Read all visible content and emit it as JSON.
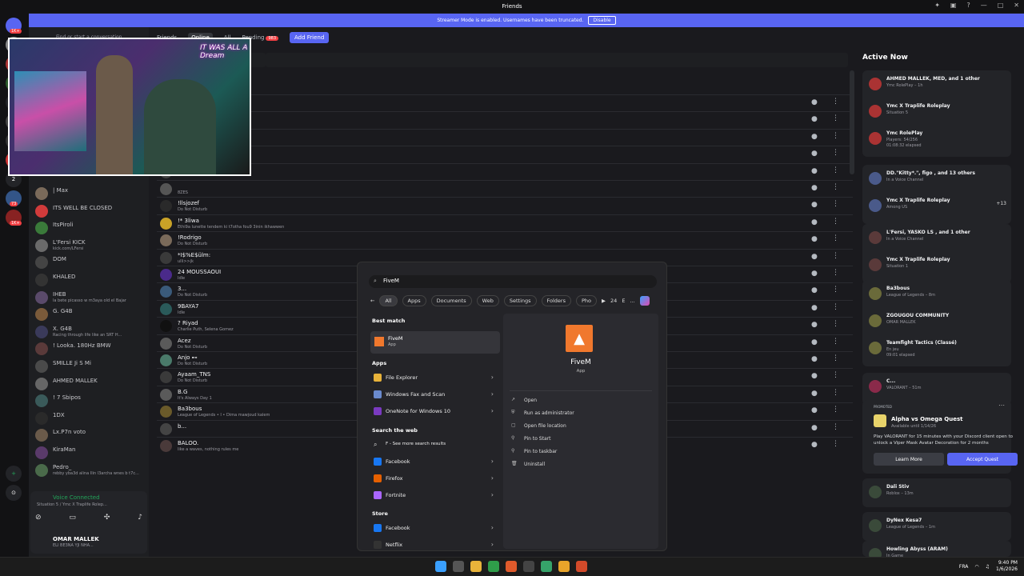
{
  "window": {
    "title": "Friends"
  },
  "banner": {
    "text": "Streamer Mode is enabled. Usernames have been truncated.",
    "button": "Disable"
  },
  "servers": [
    {
      "letter": "",
      "color": "#5865f2",
      "badge": "1K+"
    },
    {
      "letter": "",
      "color": "#888888",
      "badge": "460"
    },
    {
      "letter": "",
      "color": "#aa3333",
      "badge": "127"
    },
    {
      "letter": "",
      "color": "#2b5a2b",
      "badge": "373"
    },
    {
      "letter": "D",
      "color": "#232428",
      "badge": ""
    },
    {
      "letter": "",
      "color": "#444444",
      "badge": "116"
    },
    {
      "letter": "",
      "color": "#333333",
      "badge": "23"
    },
    {
      "letter": "",
      "color": "#cc3333",
      "badge": "227"
    },
    {
      "letter": "2",
      "color": "#232428",
      "badge": ""
    },
    {
      "letter": "",
      "color": "#335588",
      "badge": "73"
    },
    {
      "letter": "",
      "color": "#882222",
      "badge": "1K+"
    }
  ],
  "dm": {
    "search_placeholder": "Find or start a conversation",
    "items": [
      {
        "name": "| Max",
        "status": "",
        "color": "#7a6a5a"
      },
      {
        "name": "ITS WELL BE CLOSED",
        "status": "",
        "color": "#d13b3b"
      },
      {
        "name": "ItsPiroli",
        "status": "",
        "color": "#3a7a3a"
      },
      {
        "name": "L'Fersi KICK",
        "status": "kick.com/LFersi",
        "color": "#6a6a6a"
      },
      {
        "name": "DOM",
        "status": "",
        "color": "#444444"
      },
      {
        "name": "KHALED",
        "status": "",
        "color": "#333333"
      },
      {
        "name": "IHEB",
        "status": "la bete picasso w m3aya old el Bajar",
        "color": "#5a4a6a"
      },
      {
        "name": "G. G4B",
        "status": "",
        "color": "#7a5a3a"
      },
      {
        "name": "X. G4B",
        "status": "Racing through life like an SRT H...",
        "color": "#3a3a5a"
      },
      {
        "name": "! Lооkа. 180Hz BMW",
        "status": "",
        "color": "#5a3a3a"
      },
      {
        "name": "SMILLE Ji S Mi",
        "status": "",
        "color": "#4a4a4a"
      },
      {
        "name": "AHMED MALLEK",
        "status": "",
        "color": "#666666"
      },
      {
        "name": "! 7 Sbipos",
        "status": "",
        "color": "#3a5a5a"
      },
      {
        "name": "1DX",
        "status": "",
        "color": "#2a2a2a"
      },
      {
        "name": "Lx.P7n voto",
        "status": "",
        "color": "#6a5a4a"
      },
      {
        "name": "KiraMan",
        "status": "",
        "color": "#5a3a6a"
      },
      {
        "name": "Pedro_",
        "status": "rebby yba3d alina Ilin l3archa wnes b t7c...",
        "color": "#4a6a4a"
      }
    ],
    "voice": {
      "title": "Voice Connected",
      "sub": "Situation 5 / Ymc X Traplife Rolep..."
    },
    "user": {
      "name": "OMAR MALLEK",
      "status": "ELI BE3NA YJI NHA..."
    }
  },
  "nav": {
    "friends": "Friends",
    "online": "Online",
    "all": "All",
    "pending": "Pending",
    "pending_count": "983",
    "add": "Add Friend"
  },
  "friends": [
    {
      "name": "",
      "status": "",
      "color": "#444444"
    },
    {
      "name": "",
      "status": "",
      "color": "#444444"
    },
    {
      "name": "",
      "status": "",
      "color": "#444444"
    },
    {
      "name": "",
      "status": "",
      "color": "#444444"
    },
    {
      "name": "",
      "status": "",
      "color": "#444444"
    },
    {
      "name": "",
      "status": "8ZES",
      "color": "#555555"
    },
    {
      "name": "!llsjozef",
      "status": "Do Not Disturb",
      "color": "#2a2a2a"
    },
    {
      "name": "!* 3liwa",
      "status": "Ethi9a lunette tendem ki t7otha fou9 3inin ikhawwen",
      "color": "#c9a227"
    },
    {
      "name": "!Rodrigo",
      "status": "Do Not Disturb",
      "color": "#7a6a5a"
    },
    {
      "name": "*I$%E$ülm:",
      "status": "ulli>>jk",
      "color": "#3a3a3a"
    },
    {
      "name": "24 MOUSSAOUI",
      "status": "Idle",
      "color": "#4a2a8a"
    },
    {
      "name": "3...",
      "status": "Do Not Disturb",
      "color": "#3a5a7a"
    },
    {
      "name": "9BAYA7",
      "status": "Idle",
      "color": "#2a5a5a"
    },
    {
      "name": "? Riyad",
      "status": "Charlie Puth, Selena Gomez",
      "color": "#111111"
    },
    {
      "name": "Acez",
      "status": "Do Not Disturb",
      "color": "#5a5a5a"
    },
    {
      "name": "Anjo ⊷",
      "status": "Do Not Disturb",
      "color": "#4a7a6a"
    },
    {
      "name": "Ayaam_TNS",
      "status": "Do Not Disturb",
      "color": "#3a3a3a"
    },
    {
      "name": "B.G",
      "status": "It's Always Day 1",
      "color": "#5a5a5a"
    },
    {
      "name": "Ba3bous",
      "status": "League of Legends • I • Dima mawjoud kalem",
      "color": "#6a5a2a"
    },
    {
      "name": "b...",
      "status": "",
      "color": "#444444"
    },
    {
      "name": "BALOO.",
      "status": "like a waves, nothing rules me",
      "color": "#4a3a3a"
    }
  ],
  "stream": {
    "neon": "IT WAS ALL A Dream"
  },
  "active": {
    "title": "Active Now",
    "cards": [
      {
        "items": [
          {
            "name": "AHMED MALLEK, MED, and 1 other",
            "status": "Ymc RolePlay – 1h",
            "status2": "",
            "right": ""
          },
          {
            "name": "Ymc X Traplife Roleplay",
            "status": "Situation 5",
            "status2": "",
            "right": ""
          },
          {
            "name": "Ymc RolePlay",
            "status": "Players: 54/256",
            "status2": "01:08:32 elapsed",
            "right": ""
          }
        ]
      },
      {
        "items": [
          {
            "name": "DD.\"Kitty*.\", figo , and 13 others",
            "status": "In a Voice Channel",
            "status2": "",
            "right": ""
          },
          {
            "name": "Ymc X Traplife Roleplay",
            "status": "Among US",
            "status2": "",
            "right": "+13"
          }
        ]
      },
      {
        "items": [
          {
            "name": "L'Fersi, YASKO LS , and 1 other",
            "status": "In a Voice Channel",
            "status2": "",
            "right": ""
          },
          {
            "name": "Ymc X Traplife Roleplay",
            "status": "Situation 1",
            "status2": "",
            "right": ""
          }
        ]
      },
      {
        "items": [
          {
            "name": "Ba3bous",
            "status": "League of Legends – 8m",
            "status2": "",
            "right": ""
          },
          {
            "name": "ZGOUGOU COMMUNITY",
            "status": "OMAR MALLEK",
            "status2": "",
            "right": ""
          },
          {
            "name": "Teamfight Tactics (Classé)",
            "status": "En jeu",
            "status2": "09:01 elapsed",
            "right": ""
          }
        ]
      },
      {
        "items": [
          {
            "name": "C...",
            "status": "VALORANT – 51m",
            "status2": "",
            "right": ""
          }
        ]
      }
    ],
    "promo": {
      "label": "PROMOTED",
      "name": "Alpha vs Omega Quest",
      "avail": "Available until 1/14/26",
      "desc": "Play VALORANT for 15 minutes with your Discord client open to unlock a Viper Mask Avatar Decoration for 2 months",
      "learn": "Learn More",
      "accept": "Accept Quest"
    },
    "after": [
      {
        "name": "Dali Stiv",
        "status": "Roblox – 13m"
      },
      {
        "name": "DyNex Kesa7",
        "status": "League of Legends – 1m"
      },
      {
        "name": "Howling Abyss (ARAM)",
        "status": "In Game"
      }
    ]
  },
  "start": {
    "query": "FiveM",
    "tabs": [
      "All",
      "Apps",
      "Documents",
      "Web",
      "Settings",
      "Folders",
      "Pho"
    ],
    "tabs_extra": {
      "count": "24",
      "letter": "E",
      "more": "..."
    },
    "best_match": "Best match",
    "best": {
      "name": "FiveM",
      "type": "App"
    },
    "apps_h": "Apps",
    "apps": [
      "File Explorer",
      "Windows Fax and Scan",
      "OneNote for Windows 10"
    ],
    "web_h": "Search the web",
    "web": [
      "F - See more search results",
      "Facebook",
      "Firefox",
      "Fortnite"
    ],
    "store_h": "Store",
    "store": [
      "Facebook",
      "Netflix"
    ],
    "detail": {
      "name": "FiveM",
      "type": "App"
    },
    "actions": [
      "Open",
      "Run as administrator",
      "Open file location",
      "Pin to Start",
      "Pin to taskbar",
      "Uninstall"
    ]
  },
  "taskbar": {
    "lang": "FRA",
    "time": "9:40 PM",
    "date": "1/6/2026"
  }
}
